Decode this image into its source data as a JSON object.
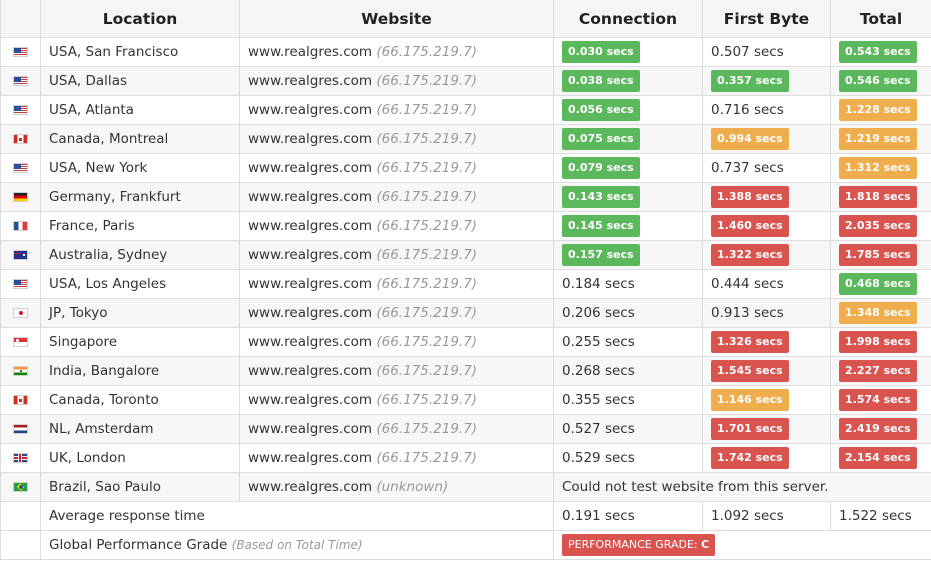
{
  "headers": {
    "location": "Location",
    "website": "Website",
    "connection": "Connection",
    "first_byte": "First Byte",
    "total": "Total"
  },
  "rows": [
    {
      "flag": "us",
      "location": "USA, San Francisco",
      "site": "www.realgres.com",
      "ip": "(66.175.219.7)",
      "connection": {
        "text": "0.030 secs",
        "level": "green"
      },
      "first_byte": {
        "text": "0.507 secs",
        "level": "none"
      },
      "total": {
        "text": "0.543 secs",
        "level": "green"
      }
    },
    {
      "flag": "us",
      "location": "USA, Dallas",
      "site": "www.realgres.com",
      "ip": "(66.175.219.7)",
      "connection": {
        "text": "0.038 secs",
        "level": "green"
      },
      "first_byte": {
        "text": "0.357 secs",
        "level": "green"
      },
      "total": {
        "text": "0.546 secs",
        "level": "green"
      }
    },
    {
      "flag": "us",
      "location": "USA, Atlanta",
      "site": "www.realgres.com",
      "ip": "(66.175.219.7)",
      "connection": {
        "text": "0.056 secs",
        "level": "green"
      },
      "first_byte": {
        "text": "0.716 secs",
        "level": "none"
      },
      "total": {
        "text": "1.228 secs",
        "level": "orange"
      }
    },
    {
      "flag": "ca",
      "location": "Canada, Montreal",
      "site": "www.realgres.com",
      "ip": "(66.175.219.7)",
      "connection": {
        "text": "0.075 secs",
        "level": "green"
      },
      "first_byte": {
        "text": "0.994 secs",
        "level": "orange"
      },
      "total": {
        "text": "1.219 secs",
        "level": "orange"
      }
    },
    {
      "flag": "us",
      "location": "USA, New York",
      "site": "www.realgres.com",
      "ip": "(66.175.219.7)",
      "connection": {
        "text": "0.079 secs",
        "level": "green"
      },
      "first_byte": {
        "text": "0.737 secs",
        "level": "none"
      },
      "total": {
        "text": "1.312 secs",
        "level": "orange"
      }
    },
    {
      "flag": "de",
      "location": "Germany, Frankfurt",
      "site": "www.realgres.com",
      "ip": "(66.175.219.7)",
      "connection": {
        "text": "0.143 secs",
        "level": "green"
      },
      "first_byte": {
        "text": "1.388 secs",
        "level": "red"
      },
      "total": {
        "text": "1.818 secs",
        "level": "red"
      }
    },
    {
      "flag": "fr",
      "location": "France, Paris",
      "site": "www.realgres.com",
      "ip": "(66.175.219.7)",
      "connection": {
        "text": "0.145 secs",
        "level": "green"
      },
      "first_byte": {
        "text": "1.460 secs",
        "level": "red"
      },
      "total": {
        "text": "2.035 secs",
        "level": "red"
      }
    },
    {
      "flag": "au",
      "location": "Australia, Sydney",
      "site": "www.realgres.com",
      "ip": "(66.175.219.7)",
      "connection": {
        "text": "0.157 secs",
        "level": "green"
      },
      "first_byte": {
        "text": "1.322 secs",
        "level": "red"
      },
      "total": {
        "text": "1.785 secs",
        "level": "red"
      }
    },
    {
      "flag": "us",
      "location": "USA, Los Angeles",
      "site": "www.realgres.com",
      "ip": "(66.175.219.7)",
      "connection": {
        "text": "0.184 secs",
        "level": "none"
      },
      "first_byte": {
        "text": "0.444 secs",
        "level": "none"
      },
      "total": {
        "text": "0.468 secs",
        "level": "green"
      }
    },
    {
      "flag": "jp",
      "location": "JP, Tokyo",
      "site": "www.realgres.com",
      "ip": "(66.175.219.7)",
      "connection": {
        "text": "0.206 secs",
        "level": "none"
      },
      "first_byte": {
        "text": "0.913 secs",
        "level": "none"
      },
      "total": {
        "text": "1.348 secs",
        "level": "orange"
      }
    },
    {
      "flag": "sg",
      "location": "Singapore",
      "site": "www.realgres.com",
      "ip": "(66.175.219.7)",
      "connection": {
        "text": "0.255 secs",
        "level": "none"
      },
      "first_byte": {
        "text": "1.326 secs",
        "level": "red"
      },
      "total": {
        "text": "1.998 secs",
        "level": "red"
      }
    },
    {
      "flag": "in",
      "location": "India, Bangalore",
      "site": "www.realgres.com",
      "ip": "(66.175.219.7)",
      "connection": {
        "text": "0.268 secs",
        "level": "none"
      },
      "first_byte": {
        "text": "1.545 secs",
        "level": "red"
      },
      "total": {
        "text": "2.227 secs",
        "level": "red"
      }
    },
    {
      "flag": "ca",
      "location": "Canada, Toronto",
      "site": "www.realgres.com",
      "ip": "(66.175.219.7)",
      "connection": {
        "text": "0.355 secs",
        "level": "none"
      },
      "first_byte": {
        "text": "1.146 secs",
        "level": "orange"
      },
      "total": {
        "text": "1.574 secs",
        "level": "red"
      }
    },
    {
      "flag": "nl",
      "location": "NL, Amsterdam",
      "site": "www.realgres.com",
      "ip": "(66.175.219.7)",
      "connection": {
        "text": "0.527 secs",
        "level": "none"
      },
      "first_byte": {
        "text": "1.701 secs",
        "level": "red"
      },
      "total": {
        "text": "2.419 secs",
        "level": "red"
      }
    },
    {
      "flag": "gb",
      "location": "UK, London",
      "site": "www.realgres.com",
      "ip": "(66.175.219.7)",
      "connection": {
        "text": "0.529 secs",
        "level": "none"
      },
      "first_byte": {
        "text": "1.742 secs",
        "level": "red"
      },
      "total": {
        "text": "2.154 secs",
        "level": "red"
      }
    }
  ],
  "brazil_row": {
    "flag": "br",
    "location": "Brazil, Sao Paulo",
    "site": "www.realgres.com",
    "ip": "(unknown)",
    "message": "Could not test website from this server."
  },
  "average": {
    "label": "Average response time",
    "connection": "0.191 secs",
    "first_byte": "1.092 secs",
    "total": "1.522 secs"
  },
  "grade": {
    "label": "Global Performance Grade",
    "note": "(Based on Total Time)",
    "badge_label": "PERFORMANCE GRADE:",
    "badge_value": "C"
  },
  "colors": {
    "green": "#5cb85c",
    "orange": "#f0ad4e",
    "red": "#d9534f"
  }
}
